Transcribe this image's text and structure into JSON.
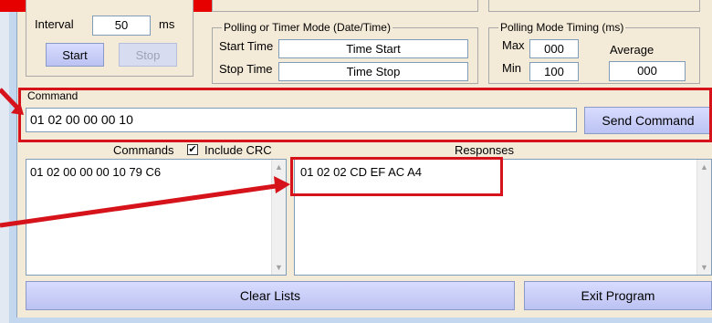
{
  "interval": {
    "label": "Interval",
    "value": "50",
    "unit": "ms"
  },
  "buttons": {
    "start": "Start",
    "stop": "Stop",
    "send_command": "Send Command",
    "clear_lists": "Clear Lists",
    "exit_program": "Exit Program"
  },
  "timer_mode": {
    "legend": "Polling  or Timer Mode  (Date/Time)",
    "start_label": "Start Time",
    "start_value": "Time Start",
    "stop_label": "Stop Time",
    "stop_value": "Time Stop"
  },
  "timing": {
    "legend": "Polling Mode Timing (ms)",
    "max_label": "Max",
    "max_value": "000",
    "min_label": "Min",
    "min_value": "100",
    "average_label": "Average",
    "average_value": "000"
  },
  "command": {
    "label": "Command",
    "value": "01 02 00 00 00 10"
  },
  "commands_list": {
    "header": "Commands",
    "include_crc_label": "Include CRC",
    "include_crc_checked": true,
    "items": [
      "01 02 00 00 00 10 79 C6"
    ]
  },
  "responses_list": {
    "header": "Responses",
    "items": [
      "01 02 02 CD EF AC A4"
    ]
  },
  "colors": {
    "annotation_red": "#d6121a",
    "panel_bg": "#f4ead8",
    "button_blue": "#c8ccf8"
  }
}
